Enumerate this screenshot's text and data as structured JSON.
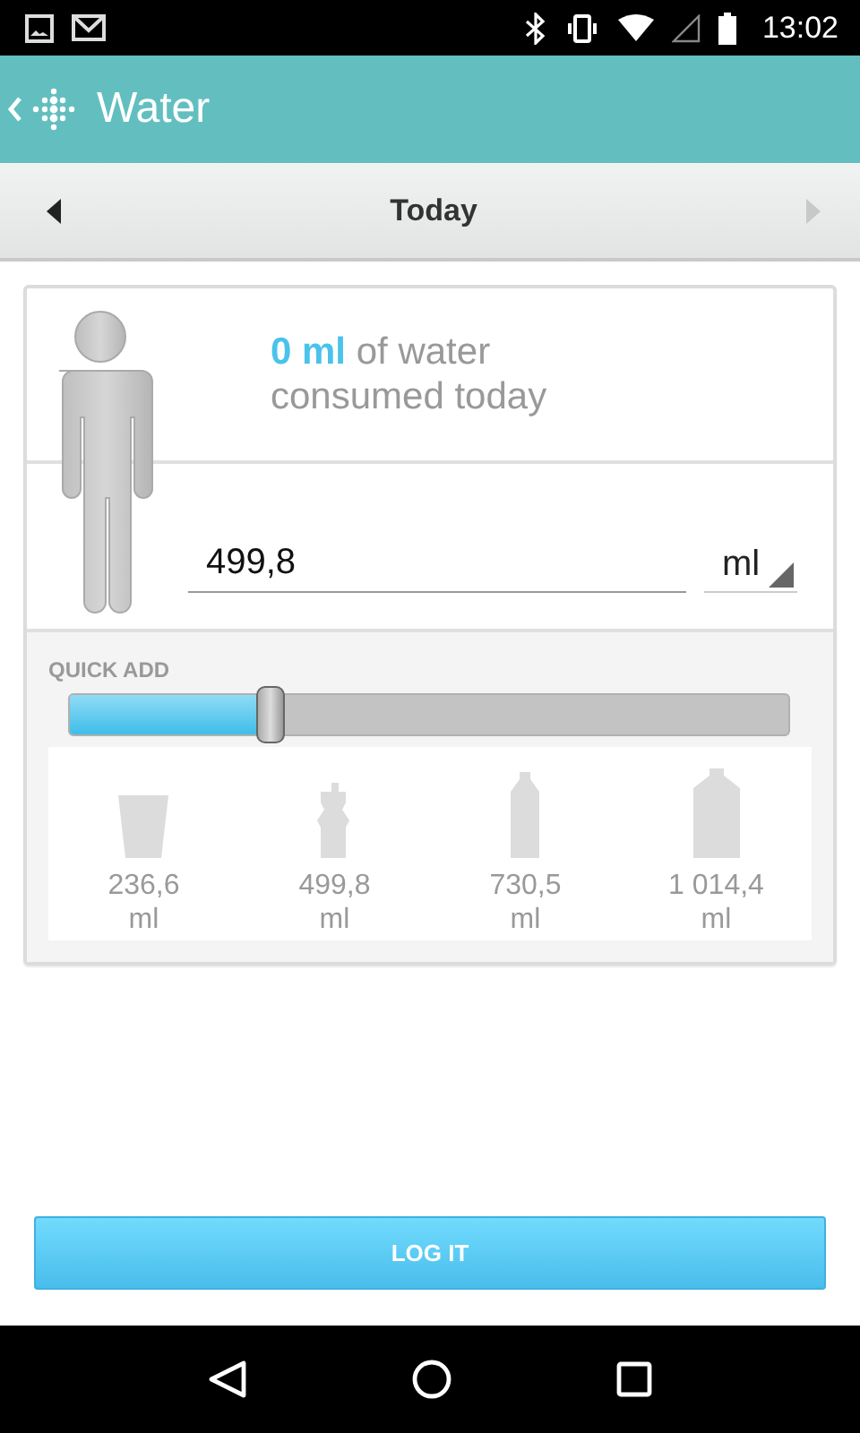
{
  "status_bar": {
    "time": "13:02"
  },
  "app_bar": {
    "title": "Water"
  },
  "date_nav": {
    "label": "Today",
    "prev_disabled": false,
    "next_disabled": true
  },
  "summary": {
    "text": "**0 ml** of water consumed today"
  },
  "entry": {
    "value": "499,8",
    "unit": "ml"
  },
  "quick_add": {
    "label": "QUICK ADD",
    "level": 0.28,
    "items": [
      {
        "kind": "cup",
        "amount": "236,6",
        "unit": "ml"
      },
      {
        "kind": "sport-bottle",
        "amount": "499,8",
        "unit": "ml"
      },
      {
        "kind": "bottle",
        "amount": "730,5",
        "unit": "ml"
      },
      {
        "kind": "jug",
        "amount": "1 014,4",
        "unit": "ml"
      }
    ]
  },
  "button": {
    "label": "LOG IT"
  }
}
